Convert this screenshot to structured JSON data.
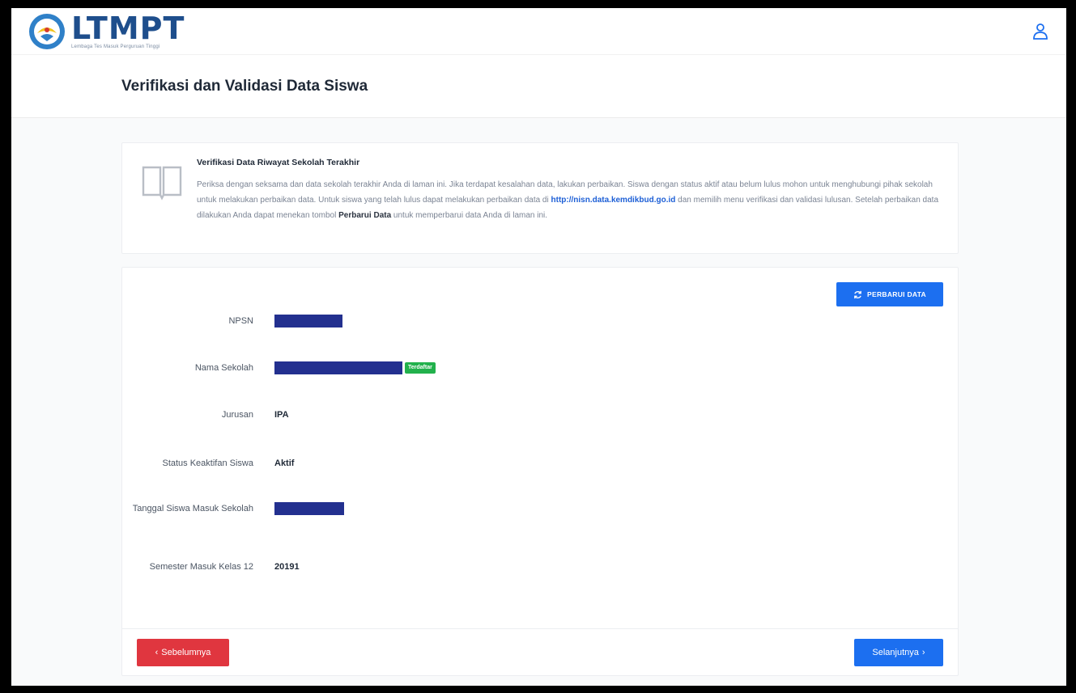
{
  "header": {
    "brand_name": "LTMPT",
    "brand_tagline": "Lembaga Tes Masuk Perguruan Tinggi",
    "page_title": "Verifikasi dan Validasi Data Siswa"
  },
  "info": {
    "title": "Verifikasi Data Riwayat Sekolah Terakhir",
    "text_1": "Periksa dengan seksama dan data sekolah terakhir Anda di laman ini. Jika terdapat kesalahan data, lakukan perbaikan. Siswa dengan status aktif atau belum lulus mohon untuk menghubungi pihak sekolah untuk melakukan perbaikan data. Untuk siswa yang telah lulus dapat melakukan perbaikan data di ",
    "link": "http://nisn.data.kemdikbud.go.id",
    "text_2": " dan memilih menu verifikasi dan validasi lulusan. Setelah perbaikan data dilakukan Anda dapat menekan tombol ",
    "bold": "Perbarui Data",
    "text_3": " untuk memperbarui data Anda di laman ini."
  },
  "form": {
    "refresh_label": "PERBARUI DATA",
    "npsn_label": "NPSN",
    "school_label": "Nama Sekolah",
    "school_badge": "Terdaftar",
    "major_label": "Jurusan",
    "major_value": "IPA",
    "status_label": "Status Keaktifan Siswa",
    "status_value": "Aktif",
    "entry_date_label": "Tanggal Siswa Masuk Sekolah",
    "semester_label": "Semester Masuk Kelas 12",
    "semester_value": "20191"
  },
  "footer": {
    "prev_label": "Sebelumnya",
    "next_label": "Selanjutnya"
  },
  "colors": {
    "primary": "#1c6ff0",
    "danger": "#e0363f",
    "success": "#22b14c",
    "redaction": "#23308f"
  }
}
